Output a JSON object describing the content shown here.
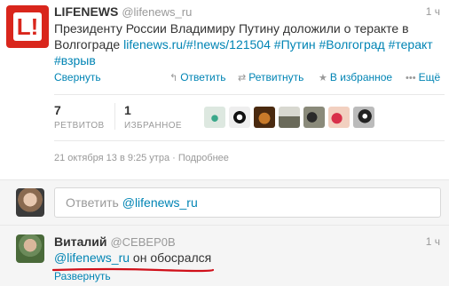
{
  "main_tweet": {
    "author_name": "LIFENEWS",
    "author_handle": "@lifenews_ru",
    "time": "1 ч",
    "avatar_logo": "L!",
    "text_plain": "Президенту России Владимиру Путину доложили о теракте в Волгограде",
    "link": "lifenews.ru/#!news/121504",
    "hashtags": [
      "#Путин",
      "#Волгоград",
      "#теракт",
      "#взрыв"
    ],
    "actions": {
      "collapse": "Свернуть",
      "reply": "Ответить",
      "retweet": "Ретвитнуть",
      "favorite": "В избранное",
      "more": "Ещё"
    },
    "stats": {
      "retweets_count": "7",
      "retweets_label": "РЕТВИТОВ",
      "favorites_count": "1",
      "favorites_label": "ИЗБРАННОЕ"
    },
    "meta": {
      "datetime": "21 октября 13 в 9:25 утра",
      "separator": "·",
      "details": "Подробнее"
    }
  },
  "reply_box": {
    "placeholder_prefix": "Ответить",
    "mention": "@lifenews_ru"
  },
  "reply_tweet": {
    "author_name": "Виталий",
    "author_handle": "@СЕВЕР0В",
    "time": "1 ч",
    "mention": "@lifenews_ru",
    "text": "он обосрался",
    "expand": "Развернуть"
  },
  "colors": {
    "link": "#0084b4",
    "muted": "#999999",
    "brand_red": "#d9261c",
    "annotation_red": "#d0101a"
  }
}
